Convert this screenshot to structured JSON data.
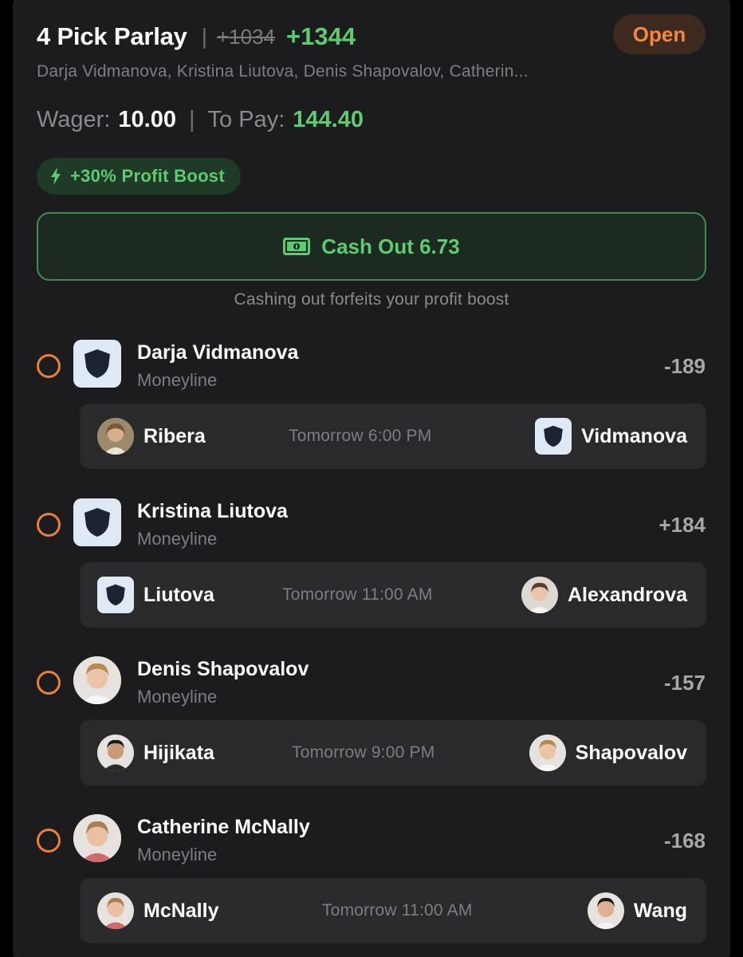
{
  "header": {
    "title": "4 Pick Parlay",
    "separator": "|",
    "original_odds": "+1034",
    "boosted_odds": "+1344",
    "status": "Open",
    "subtitle": "Darja Vidmanova, Kristina Liutova, Denis Shapovalov, Catherin..."
  },
  "wager": {
    "wager_label": "Wager:",
    "wager_value": "10.00",
    "separator": "|",
    "to_pay_label": "To Pay:",
    "to_pay_value": "144.40"
  },
  "boost": {
    "label": "+30% Profit Boost",
    "icon": "lightning-bolt-icon"
  },
  "cashout": {
    "label": "Cash Out 6.73",
    "icon": "cash-icon",
    "note": "Cashing out forfeits your profit boost"
  },
  "picks": [
    {
      "name": "Darja Vidmanova",
      "market": "Moneyline",
      "odds": "-189",
      "logo": "shield",
      "match": {
        "left": "Ribera",
        "left_avatar": "photo",
        "time": "Tomorrow 6:00 PM",
        "right": "Vidmanova",
        "right_avatar": "shield"
      }
    },
    {
      "name": "Kristina Liutova",
      "market": "Moneyline",
      "odds": "+184",
      "logo": "shield",
      "match": {
        "left": "Liutova",
        "left_avatar": "shield",
        "time": "Tomorrow 11:00 AM",
        "right": "Alexandrova",
        "right_avatar": "photo"
      }
    },
    {
      "name": "Denis Shapovalov",
      "market": "Moneyline",
      "odds": "-157",
      "logo": "photo",
      "match": {
        "left": "Hijikata",
        "left_avatar": "photo",
        "time": "Tomorrow 9:00 PM",
        "right": "Shapovalov",
        "right_avatar": "photo"
      }
    },
    {
      "name": "Catherine McNally",
      "market": "Moneyline",
      "odds": "-168",
      "logo": "photo",
      "match": {
        "left": "McNally",
        "left_avatar": "photo",
        "time": "Tomorrow 11:00 AM",
        "right": "Wang",
        "right_avatar": "photo"
      }
    }
  ],
  "colors": {
    "background": "#1c1c1e",
    "accent_green": "#5ecb72",
    "status_orange": "#f0883e",
    "radio_orange": "#e7803a",
    "muted_text": "#7d7d85"
  }
}
